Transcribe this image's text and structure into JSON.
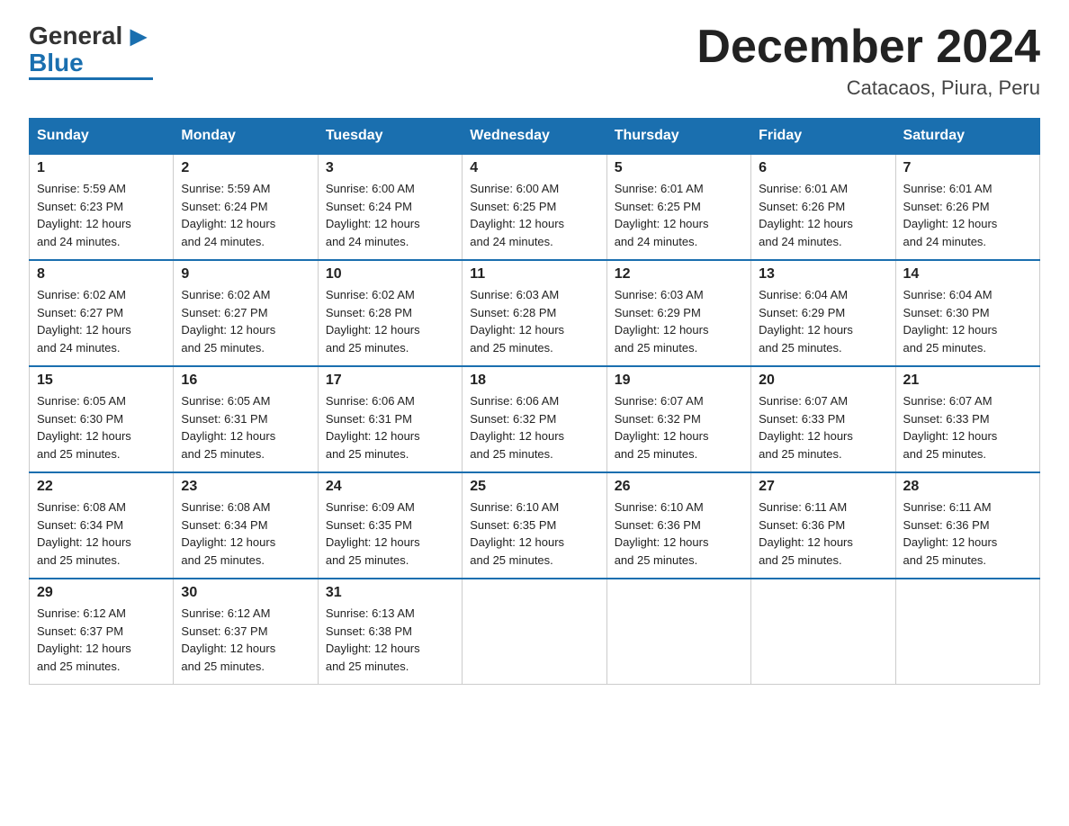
{
  "header": {
    "logo_general": "General",
    "logo_blue": "Blue",
    "main_title": "December 2024",
    "subtitle": "Catacaos, Piura, Peru"
  },
  "weekdays": [
    "Sunday",
    "Monday",
    "Tuesday",
    "Wednesday",
    "Thursday",
    "Friday",
    "Saturday"
  ],
  "weeks": [
    [
      {
        "day": "1",
        "sunrise": "5:59 AM",
        "sunset": "6:23 PM",
        "daylight": "12 hours and 24 minutes."
      },
      {
        "day": "2",
        "sunrise": "5:59 AM",
        "sunset": "6:24 PM",
        "daylight": "12 hours and 24 minutes."
      },
      {
        "day": "3",
        "sunrise": "6:00 AM",
        "sunset": "6:24 PM",
        "daylight": "12 hours and 24 minutes."
      },
      {
        "day": "4",
        "sunrise": "6:00 AM",
        "sunset": "6:25 PM",
        "daylight": "12 hours and 24 minutes."
      },
      {
        "day": "5",
        "sunrise": "6:01 AM",
        "sunset": "6:25 PM",
        "daylight": "12 hours and 24 minutes."
      },
      {
        "day": "6",
        "sunrise": "6:01 AM",
        "sunset": "6:26 PM",
        "daylight": "12 hours and 24 minutes."
      },
      {
        "day": "7",
        "sunrise": "6:01 AM",
        "sunset": "6:26 PM",
        "daylight": "12 hours and 24 minutes."
      }
    ],
    [
      {
        "day": "8",
        "sunrise": "6:02 AM",
        "sunset": "6:27 PM",
        "daylight": "12 hours and 24 minutes."
      },
      {
        "day": "9",
        "sunrise": "6:02 AM",
        "sunset": "6:27 PM",
        "daylight": "12 hours and 25 minutes."
      },
      {
        "day": "10",
        "sunrise": "6:02 AM",
        "sunset": "6:28 PM",
        "daylight": "12 hours and 25 minutes."
      },
      {
        "day": "11",
        "sunrise": "6:03 AM",
        "sunset": "6:28 PM",
        "daylight": "12 hours and 25 minutes."
      },
      {
        "day": "12",
        "sunrise": "6:03 AM",
        "sunset": "6:29 PM",
        "daylight": "12 hours and 25 minutes."
      },
      {
        "day": "13",
        "sunrise": "6:04 AM",
        "sunset": "6:29 PM",
        "daylight": "12 hours and 25 minutes."
      },
      {
        "day": "14",
        "sunrise": "6:04 AM",
        "sunset": "6:30 PM",
        "daylight": "12 hours and 25 minutes."
      }
    ],
    [
      {
        "day": "15",
        "sunrise": "6:05 AM",
        "sunset": "6:30 PM",
        "daylight": "12 hours and 25 minutes."
      },
      {
        "day": "16",
        "sunrise": "6:05 AM",
        "sunset": "6:31 PM",
        "daylight": "12 hours and 25 minutes."
      },
      {
        "day": "17",
        "sunrise": "6:06 AM",
        "sunset": "6:31 PM",
        "daylight": "12 hours and 25 minutes."
      },
      {
        "day": "18",
        "sunrise": "6:06 AM",
        "sunset": "6:32 PM",
        "daylight": "12 hours and 25 minutes."
      },
      {
        "day": "19",
        "sunrise": "6:07 AM",
        "sunset": "6:32 PM",
        "daylight": "12 hours and 25 minutes."
      },
      {
        "day": "20",
        "sunrise": "6:07 AM",
        "sunset": "6:33 PM",
        "daylight": "12 hours and 25 minutes."
      },
      {
        "day": "21",
        "sunrise": "6:07 AM",
        "sunset": "6:33 PM",
        "daylight": "12 hours and 25 minutes."
      }
    ],
    [
      {
        "day": "22",
        "sunrise": "6:08 AM",
        "sunset": "6:34 PM",
        "daylight": "12 hours and 25 minutes."
      },
      {
        "day": "23",
        "sunrise": "6:08 AM",
        "sunset": "6:34 PM",
        "daylight": "12 hours and 25 minutes."
      },
      {
        "day": "24",
        "sunrise": "6:09 AM",
        "sunset": "6:35 PM",
        "daylight": "12 hours and 25 minutes."
      },
      {
        "day": "25",
        "sunrise": "6:10 AM",
        "sunset": "6:35 PM",
        "daylight": "12 hours and 25 minutes."
      },
      {
        "day": "26",
        "sunrise": "6:10 AM",
        "sunset": "6:36 PM",
        "daylight": "12 hours and 25 minutes."
      },
      {
        "day": "27",
        "sunrise": "6:11 AM",
        "sunset": "6:36 PM",
        "daylight": "12 hours and 25 minutes."
      },
      {
        "day": "28",
        "sunrise": "6:11 AM",
        "sunset": "6:36 PM",
        "daylight": "12 hours and 25 minutes."
      }
    ],
    [
      {
        "day": "29",
        "sunrise": "6:12 AM",
        "sunset": "6:37 PM",
        "daylight": "12 hours and 25 minutes."
      },
      {
        "day": "30",
        "sunrise": "6:12 AM",
        "sunset": "6:37 PM",
        "daylight": "12 hours and 25 minutes."
      },
      {
        "day": "31",
        "sunrise": "6:13 AM",
        "sunset": "6:38 PM",
        "daylight": "12 hours and 25 minutes."
      },
      null,
      null,
      null,
      null
    ]
  ],
  "labels": {
    "sunrise": "Sunrise:",
    "sunset": "Sunset:",
    "daylight": "Daylight:"
  },
  "colors": {
    "header_bg": "#1a6faf",
    "header_text": "#ffffff",
    "border": "#aaccdd"
  }
}
